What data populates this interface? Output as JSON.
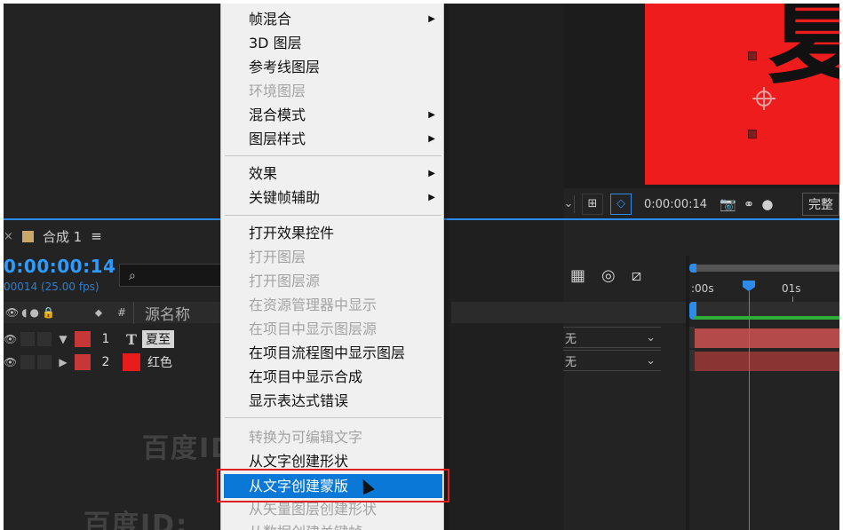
{
  "viewer": {
    "canvas_text": "夏",
    "time": "0:00:00:14",
    "quality": "完整",
    "chevron": "⌄"
  },
  "timeline": {
    "close_glyph": "×",
    "tab_title": "合成 1",
    "tab_menu": "≡",
    "timecode": "0:00:00:14",
    "frames": "00014 (25.00 fps)",
    "search_placeholder": "",
    "search_icon": "⌕",
    "col_icons": "👁◖●🔒",
    "col_tag": "⬥",
    "col_hash": "#",
    "col_source": "源名称",
    "ruler_labels": [
      ":00s",
      "01s"
    ],
    "layers": [
      {
        "eye": "👁",
        "twirl": "▼",
        "num": "1",
        "type": "T",
        "name": "夏至",
        "mode": "无"
      },
      {
        "eye": "👁",
        "twirl": "▶",
        "num": "2",
        "type": "swatch",
        "name": "红色",
        "mode": "无"
      }
    ]
  },
  "menu": {
    "items": [
      {
        "label": "帧混合",
        "disabled": false,
        "submenu": true
      },
      {
        "label": "3D 图层",
        "disabled": false,
        "submenu": false
      },
      {
        "label": "参考线图层",
        "disabled": false,
        "submenu": false
      },
      {
        "label": "环境图层",
        "disabled": true,
        "submenu": false
      },
      {
        "label": "混合模式",
        "disabled": false,
        "submenu": true
      },
      {
        "label": "图层样式",
        "disabled": false,
        "submenu": true
      },
      {
        "label": "效果",
        "disabled": false,
        "submenu": true
      },
      {
        "label": "关键帧辅助",
        "disabled": false,
        "submenu": true
      },
      {
        "label": "打开效果控件",
        "disabled": false,
        "submenu": false
      },
      {
        "label": "打开图层",
        "disabled": true,
        "submenu": false
      },
      {
        "label": "打开图层源",
        "disabled": true,
        "submenu": false
      },
      {
        "label": "在资源管理器中显示",
        "disabled": true,
        "submenu": false
      },
      {
        "label": "在项目中显示图层源",
        "disabled": true,
        "submenu": false
      },
      {
        "label": "在项目流程图中显示图层",
        "disabled": false,
        "submenu": false
      },
      {
        "label": "在项目中显示合成",
        "disabled": false,
        "submenu": false
      },
      {
        "label": "显示表达式错误",
        "disabled": false,
        "submenu": false
      },
      {
        "label": "转换为可编辑文字",
        "disabled": true,
        "submenu": false
      },
      {
        "label": "从文字创建形状",
        "disabled": false,
        "submenu": false
      },
      {
        "label": "从文字创建蒙版",
        "disabled": false,
        "submenu": false,
        "hover": true
      },
      {
        "label": "从矢量图层创建形状",
        "disabled": true,
        "submenu": false
      },
      {
        "label": "从数据创建关键帧",
        "disabled": true,
        "submenu": false
      }
    ],
    "submenu_arrow": "▶"
  },
  "watermark": {
    "text1": "百度ID:zr",
    "text2": "百度ID:"
  },
  "colors": {
    "accent": "#2d8ceb",
    "menu_hover": "#0a78d7",
    "highlight": "#e02020",
    "canvas": "#ee1c1c"
  }
}
